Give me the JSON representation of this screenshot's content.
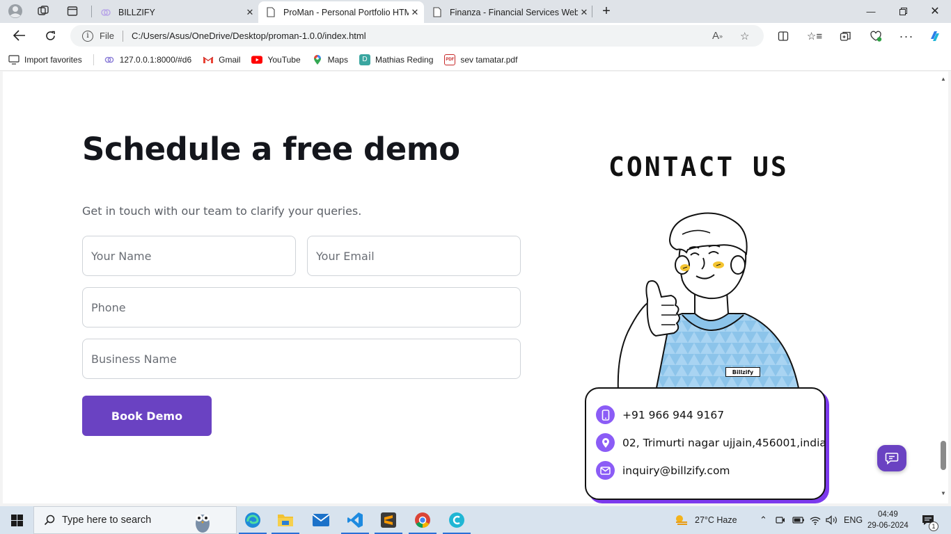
{
  "browser": {
    "tabs": [
      {
        "title": "BILLZIFY",
        "active": false
      },
      {
        "title": "ProMan - Personal Portfolio HTM",
        "active": true
      },
      {
        "title": "Finanza - Financial Services Web",
        "active": false
      }
    ],
    "address": {
      "scheme_label": "File",
      "url": "C:/Users/Asus/OneDrive/Desktop/proman-1.0.0/index.html"
    },
    "favorites": [
      {
        "label": "Import favorites",
        "icon": "import-icon"
      },
      {
        "label": "127.0.0.1:8000/#d6",
        "icon": "local-site-icon"
      },
      {
        "label": "Gmail",
        "icon": "gmail-icon"
      },
      {
        "label": "YouTube",
        "icon": "youtube-icon"
      },
      {
        "label": "Maps",
        "icon": "maps-icon"
      },
      {
        "label": "Mathias Reding",
        "icon": "site-icon"
      },
      {
        "label": "sev tamatar.pdf",
        "icon": "pdf-icon"
      }
    ]
  },
  "page": {
    "title": "Schedule a free demo",
    "subtitle": "Get in touch with our team to clarify your queries.",
    "form": {
      "name_placeholder": "Your Name",
      "email_placeholder": "Your Email",
      "phone_placeholder": "Phone",
      "business_placeholder": "Business Name",
      "submit_label": "Book Demo"
    },
    "contact": {
      "heading": "CONTACT US",
      "badge": "Billzify",
      "phone": "+91 966 944 9167",
      "address": "02, Trimurti nagar ujjain,456001,india",
      "email": "inquiry@billzify.com"
    },
    "accent_color": "#6a42c2"
  },
  "taskbar": {
    "search_placeholder": "Type here to search",
    "weather": "27°C  Haze",
    "language": "ENG",
    "time": "04:49",
    "date": "29-06-2024",
    "notification_count": "1"
  }
}
